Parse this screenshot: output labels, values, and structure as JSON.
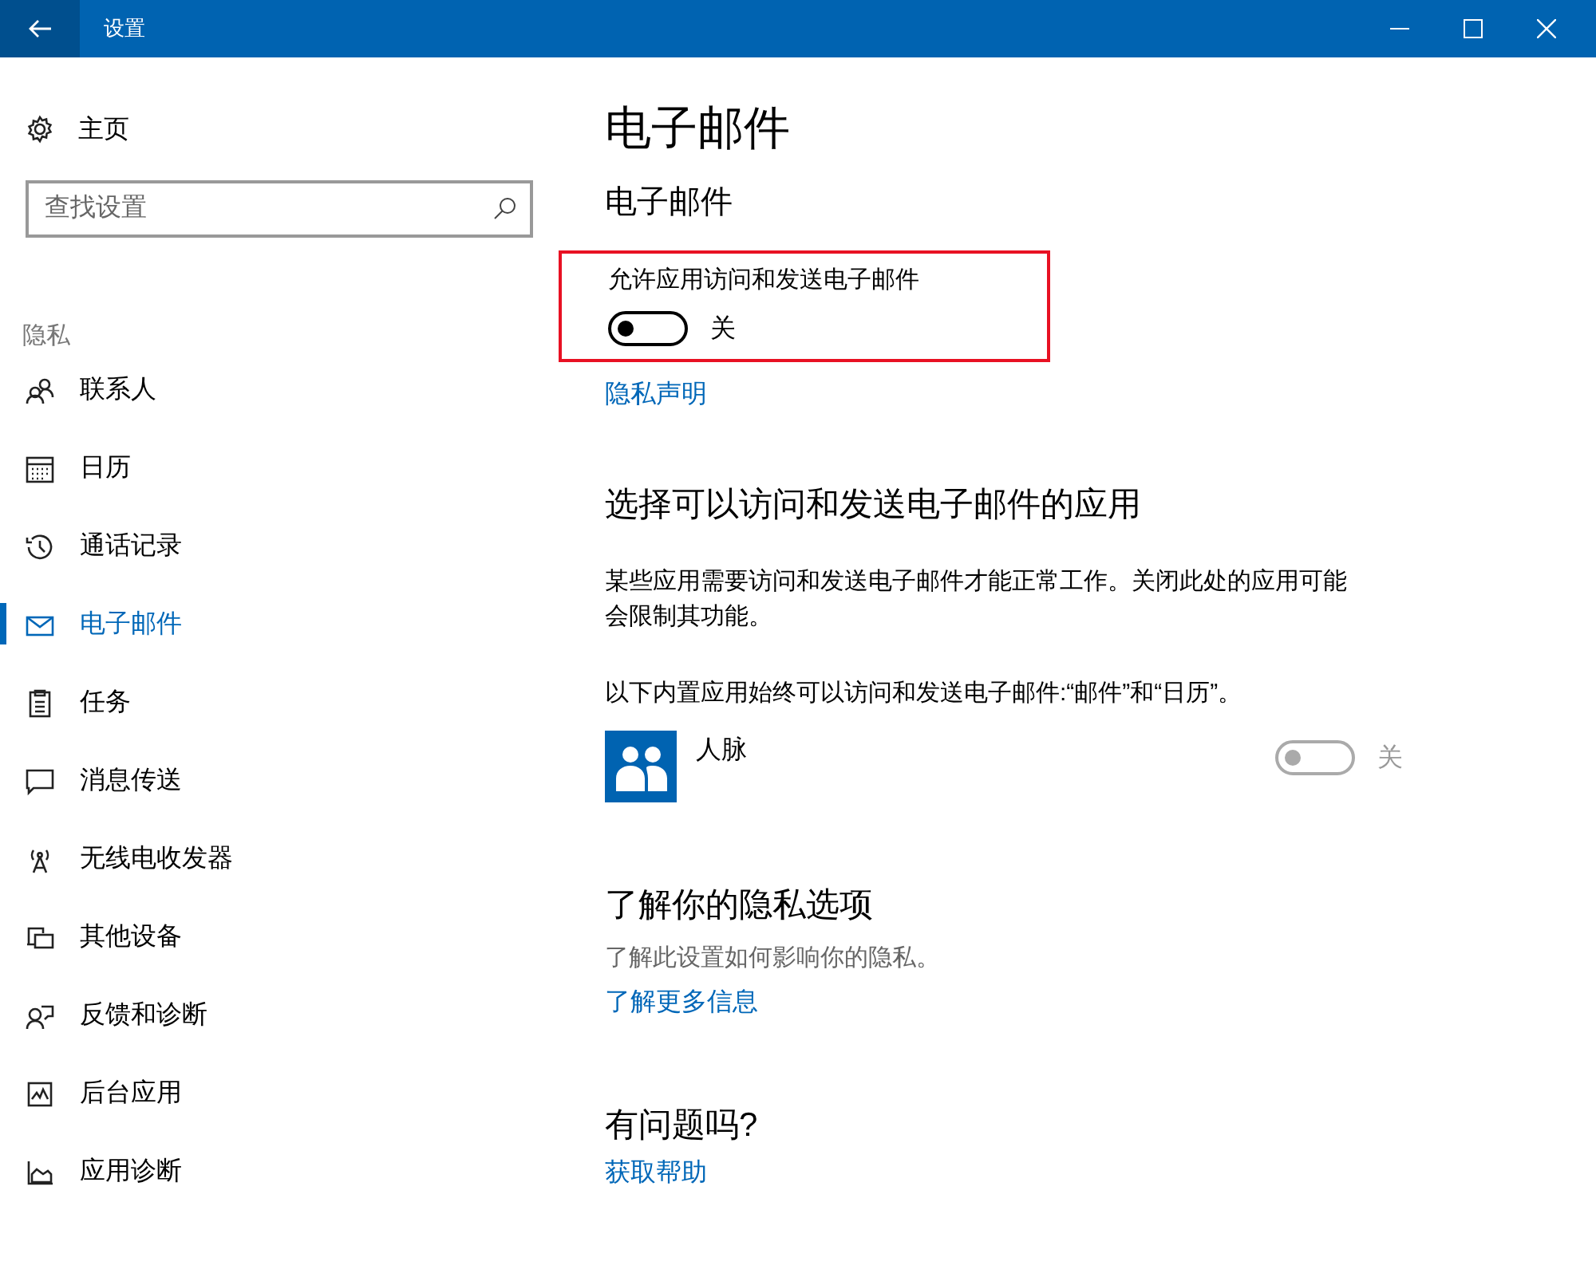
{
  "window": {
    "title": "设置"
  },
  "sidebar": {
    "home": "主页",
    "search": {
      "placeholder": "查找设置"
    },
    "group": "隐私",
    "items": [
      {
        "label": "联系人",
        "selected": false
      },
      {
        "label": "日历",
        "selected": false
      },
      {
        "label": "通话记录",
        "selected": false
      },
      {
        "label": "电子邮件",
        "selected": true
      },
      {
        "label": "任务",
        "selected": false
      },
      {
        "label": "消息传送",
        "selected": false
      },
      {
        "label": "无线电收发器",
        "selected": false
      },
      {
        "label": "其他设备",
        "selected": false
      },
      {
        "label": "反馈和诊断",
        "selected": false
      },
      {
        "label": "后台应用",
        "selected": false
      },
      {
        "label": "应用诊断",
        "selected": false
      }
    ]
  },
  "page": {
    "title": "电子邮件",
    "subtitle": "电子邮件",
    "master_toggle": {
      "label": "允许应用访问和发送电子邮件",
      "on": false,
      "state_text": "关",
      "highlighted": true
    },
    "privacy_link": "隐私声明",
    "apps_section": {
      "heading": "选择可以访问和发送电子邮件的应用",
      "description": "某些应用需要访问和发送电子邮件才能正常工作。关闭此处的应用可能会限制其功能。",
      "note": "以下内置应用始终可以访问和发送电子邮件:“邮件”和“日历”。",
      "apps": [
        {
          "name": "人脉",
          "on": false,
          "disabled": true,
          "state_text": "关"
        }
      ]
    },
    "learn_section": {
      "heading": "了解你的隐私选项",
      "text": "了解此设置如何影响你的隐私。",
      "link": "了解更多信息"
    },
    "help_section": {
      "heading": "有问题吗?",
      "link": "获取帮助"
    }
  }
}
